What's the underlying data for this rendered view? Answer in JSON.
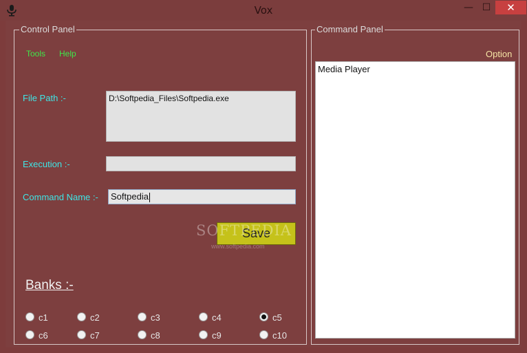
{
  "window": {
    "title": "Vox",
    "minimize": "—",
    "maximize": "☐",
    "close": "✕"
  },
  "control_panel": {
    "legend": "Control Panel",
    "menu": [
      "Tools",
      "Help"
    ],
    "file_path_label": "File Path :-",
    "file_path_value": "D:\\Softpedia_Files\\Softpedia.exe",
    "execution_label": "Execution :-",
    "execution_value": "",
    "command_name_label": "Command Name :-",
    "command_name_value": "Softpedia",
    "save_label": "Save",
    "watermark": "SOFTPEDIA",
    "watermark_url": "www.softpedia.com",
    "banks_label": "Banks :-",
    "banks": [
      {
        "label": "c1",
        "checked": false
      },
      {
        "label": "c2",
        "checked": false
      },
      {
        "label": "c3",
        "checked": false
      },
      {
        "label": "c4",
        "checked": false
      },
      {
        "label": "c5",
        "checked": true
      },
      {
        "label": "c6",
        "checked": false
      },
      {
        "label": "c7",
        "checked": false
      },
      {
        "label": "c8",
        "checked": false
      },
      {
        "label": "c9",
        "checked": false
      },
      {
        "label": "c10",
        "checked": false
      }
    ]
  },
  "command_panel": {
    "legend": "Command Panel",
    "option_label": "Option",
    "commands": [
      "Media Player"
    ]
  },
  "colors": {
    "background": "#7d3f3f",
    "menu_text": "#3fe84a",
    "label_text": "#3ee6e6",
    "save_button": "#c5c21a"
  }
}
